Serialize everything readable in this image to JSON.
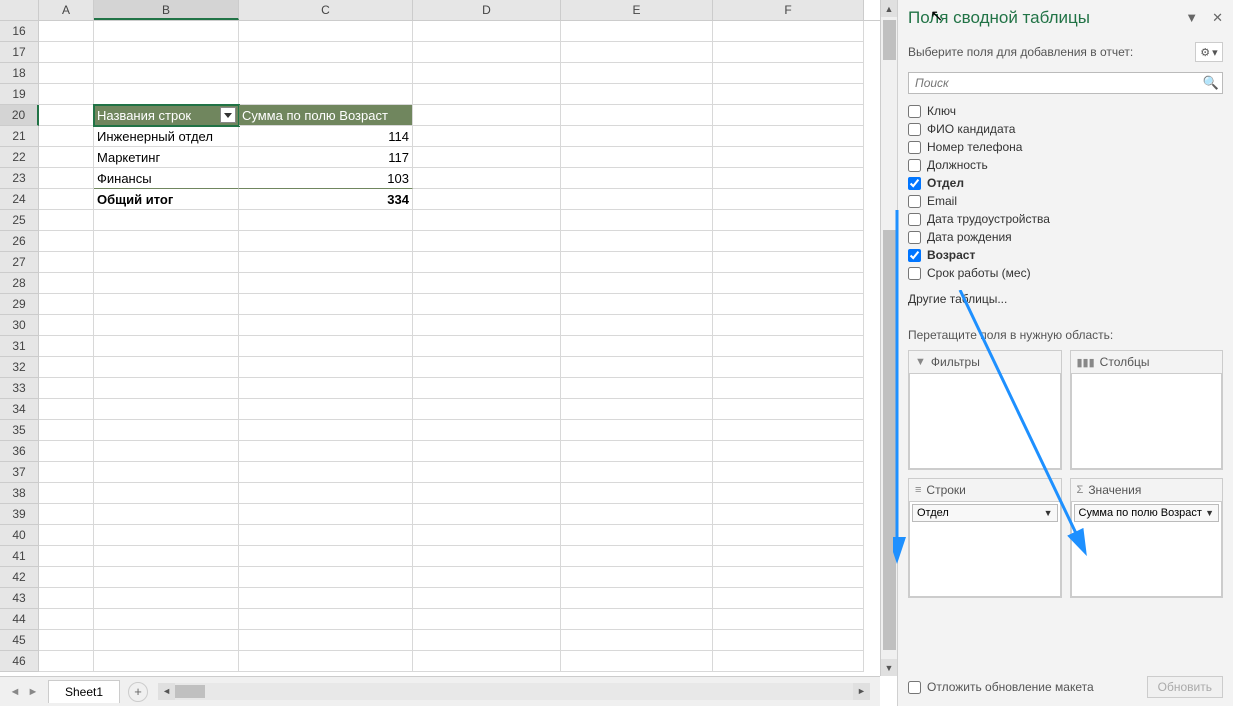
{
  "columns": [
    "A",
    "B",
    "C",
    "D",
    "E",
    "F"
  ],
  "row_start": 16,
  "row_end": 46,
  "selected_cell": {
    "col": "B",
    "row": 20
  },
  "pivot": {
    "header_row_labels": "Названия строк",
    "header_sum": "Сумма по полю Возраст",
    "rows": [
      {
        "label": "Инженерный отдел",
        "value": "114"
      },
      {
        "label": "Маркетинг",
        "value": "117"
      },
      {
        "label": "Финансы",
        "value": "103"
      }
    ],
    "total_label": "Общий итог",
    "total_value": "334"
  },
  "sheet_tab": "Sheet1",
  "panel": {
    "title": "Поля сводной таблицы",
    "subtitle": "Выберите поля для добавления в отчет:",
    "search_placeholder": "Поиск",
    "fields": [
      {
        "label": "Ключ",
        "checked": false
      },
      {
        "label": "ФИО кандидата",
        "checked": false
      },
      {
        "label": "Номер телефона",
        "checked": false
      },
      {
        "label": "Должность",
        "checked": false
      },
      {
        "label": "Отдел",
        "checked": true
      },
      {
        "label": "Email",
        "checked": false
      },
      {
        "label": "Дата трудоустройства",
        "checked": false
      },
      {
        "label": "Дата рождения",
        "checked": false
      },
      {
        "label": "Возраст",
        "checked": true
      },
      {
        "label": "Срок работы (мес)",
        "checked": false
      }
    ],
    "other_tables": "Другие таблицы...",
    "drag_label": "Перетащите поля в нужную область:",
    "zones": {
      "filters": {
        "label": "Фильтры",
        "items": []
      },
      "columns": {
        "label": "Столбцы",
        "items": []
      },
      "rows": {
        "label": "Строки",
        "items": [
          "Отдел"
        ]
      },
      "values": {
        "label": "Значения",
        "items": [
          "Сумма по полю Возраст"
        ]
      }
    },
    "defer_label": "Отложить обновление макета",
    "update_label": "Обновить"
  }
}
